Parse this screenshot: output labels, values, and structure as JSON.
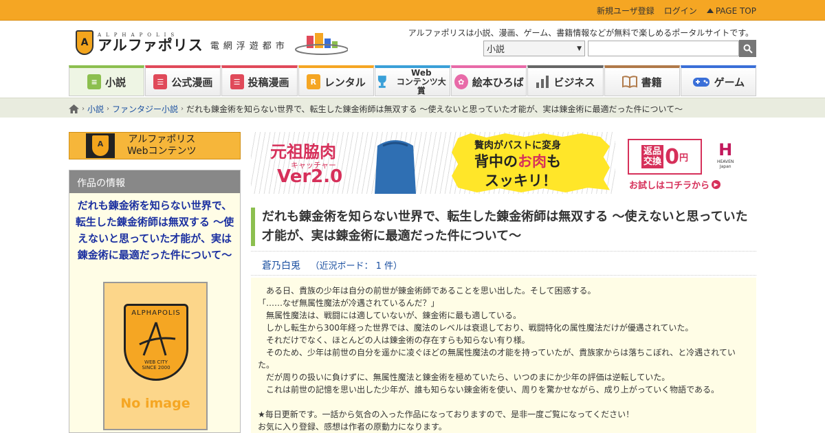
{
  "topbar": {
    "register": "新規ユーザ登録",
    "login": "ログイン",
    "page_top": "PAGE TOP"
  },
  "header": {
    "logo_shield": "A",
    "logo_small": "ALPHAPOLIS",
    "logo_main": "アルファポリス",
    "logo_sub": "電網浮遊都市",
    "tagline": "アルファポリスは小説、漫画、ゲーム、書籍情報などが無料で楽しめるポータルサイトです。",
    "category_select": "小説",
    "search_placeholder": ""
  },
  "nav": {
    "items": [
      {
        "label": "小説",
        "color": "#8cbf4f",
        "icon": "book-icon"
      },
      {
        "label": "公式漫画",
        "color": "#e04a5a",
        "icon": "manga-icon"
      },
      {
        "label": "投稿漫画",
        "color": "#e04a5a",
        "icon": "manga-post-icon"
      },
      {
        "label": "レンタル",
        "color": "#f5a623",
        "icon": "rental-icon"
      },
      {
        "label_top": "Web",
        "label_bottom": "コンテンツ大賞",
        "color": "#3aa0d8",
        "icon": "trophy-icon"
      },
      {
        "label": "絵本ひろば",
        "color": "#e86aa8",
        "icon": "picture-book-icon"
      },
      {
        "label": "ビジネス",
        "color": "#666666",
        "icon": "chart-bars-icon"
      },
      {
        "label": "書籍",
        "color": "#b07a4a",
        "icon": "open-book-icon"
      },
      {
        "label": "ゲーム",
        "color": "#3a6fd8",
        "icon": "gamepad-icon"
      }
    ]
  },
  "breadcrumb": {
    "home_icon": "home-icon",
    "level1": "小説",
    "level2": "ファンタジー小説",
    "current": "だれも錬金術を知らない世界で、転生した錬金術師は無双する 〜使えないと思っていた才能が、実は錬金術に最適だった件について〜"
  },
  "sidebar": {
    "banner_line1": "アルファポリス",
    "banner_line2": "Webコンテンツ",
    "info_header": "作品の情報",
    "info_title": "だれも錬金術を知らない世界で、転生した錬金術師は無双する 〜使えないと思っていた才能が、実は錬金術に最適だった件について〜",
    "cover_top": "ALPHAPOLIS",
    "cover_bottom": "WEB CITY\nSINCE 2000",
    "no_image": "No image"
  },
  "ad": {
    "title_a": "元祖脇肉",
    "title_b": "キャッチャー",
    "title_c": "Ver2.0",
    "yellow_1": "贅肉がバストに変身",
    "yellow_2a": "背中の",
    "yellow_2b": "お肉",
    "yellow_2c": "も",
    "yellow_3": "スッキリ！",
    "return_a": "返品\n交換",
    "return_b": "0",
    "return_c": "円",
    "brand": "H",
    "brand_sub": "HEAVEN\nJapan",
    "cta": "お試しはコチラから"
  },
  "work": {
    "title": "だれも錬金術を知らない世界で、転生した錬金術師は無双する 〜使えないと思っていた才能が、実は錬金術に最適だった件について〜",
    "author": "蒼乃白兎",
    "board": "（近況ボード： 1 件）",
    "synopsis": [
      "　ある日、貴族の少年は自分の前世が錬金術師であることを思い出した。そして困惑する。",
      "「……なぜ無属性魔法が冷遇されているんだ？」",
      "　無属性魔法は、戦闘には適していないが、錬金術に最も適している。",
      "　しかし転生から300年経った世界では、魔法のレベルは衰退しており、戦闘特化の属性魔法だけが優遇されていた。",
      "　それだけでなく、ほとんどの人は錬金術の存在すらも知らない有り様。",
      "　そのため、少年は前世の自分を遥かに凌ぐほどの無属性魔法の才能を持っていたが、貴族家からは落ちこぼれ、と冷遇されていた。",
      "　だが周りの扱いに負けずに、無属性魔法と錬金術を極めていたら、いつのまにか少年の評価は逆転していた。",
      "　これは前世の記憶を思い出した少年が、誰も知らない錬金術を使い、周りを驚かせながら、成り上がっていく物語である。",
      "",
      "★毎日更新です。一話から気合の入った作品になっておりますので、是非一度ご覧になってください！",
      "お気に入り登録、感想は作者の原動力になります。"
    ]
  }
}
